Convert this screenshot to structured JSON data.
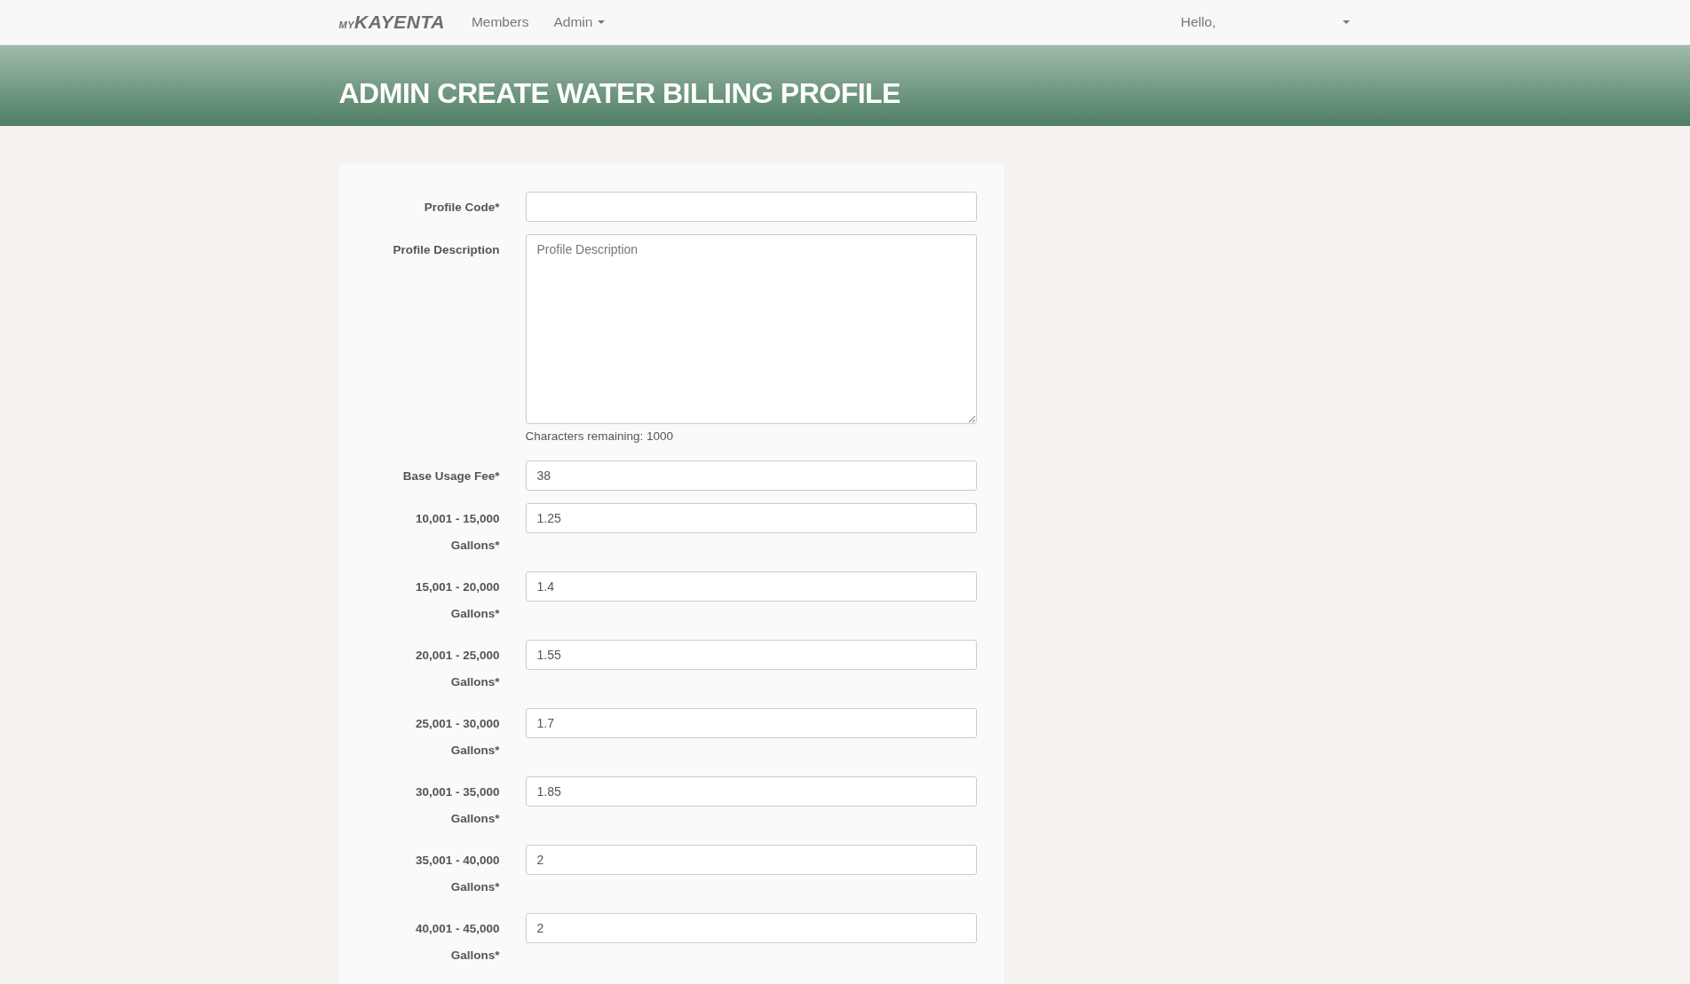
{
  "navbar": {
    "logo": {
      "prefix": "MY",
      "name": "KAYENTA"
    },
    "links": [
      {
        "label": "Members",
        "dropdown": false
      },
      {
        "label": "Admin",
        "dropdown": true
      }
    ],
    "user_menu": {
      "label": "Hello,"
    }
  },
  "page_title": "ADMIN CREATE WATER BILLING PROFILE",
  "form": {
    "fields": [
      {
        "kind": "input",
        "label": "Profile Code*"
      },
      {
        "kind": "textarea",
        "label": "Profile Description",
        "placeholder": "Profile Description",
        "hint": "Characters remaining: 1000"
      },
      {
        "kind": "input",
        "label": "Base Usage Fee*",
        "value": "38"
      },
      {
        "kind": "input",
        "label": "10,001 - 15,000 Gallons*",
        "value": "1.25"
      },
      {
        "kind": "input",
        "label": "15,001 - 20,000 Gallons*",
        "value": "1.4"
      },
      {
        "kind": "input",
        "label": "20,001 - 25,000 Gallons*",
        "value": "1.55"
      },
      {
        "kind": "input",
        "label": "25,001 - 30,000 Gallons*",
        "value": "1.7"
      },
      {
        "kind": "input",
        "label": "30,001 - 35,000 Gallons*",
        "value": "1.85"
      },
      {
        "kind": "input",
        "label": "35,001 - 40,000 Gallons*",
        "value": "2"
      },
      {
        "kind": "input",
        "label": "40,001 - 45,000 Gallons*",
        "value": "2"
      }
    ]
  }
}
